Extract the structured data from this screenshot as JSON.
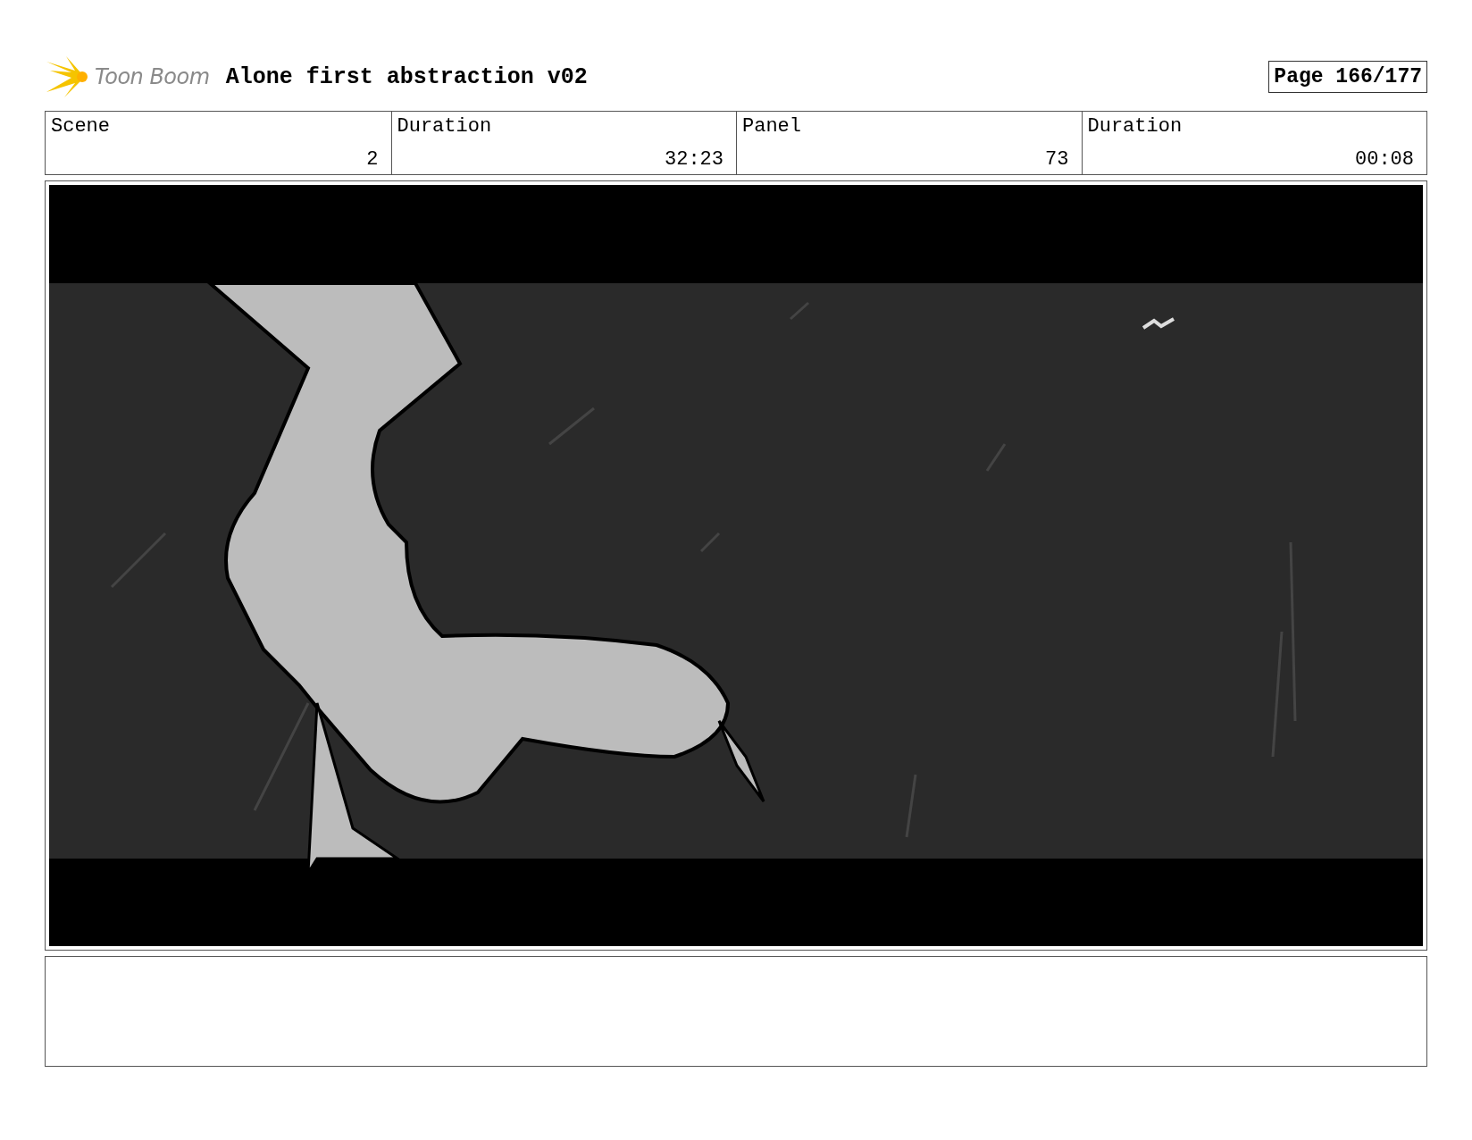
{
  "header": {
    "logo_text": "Toon Boom",
    "title": "Alone first abstraction v02",
    "page": "Page 166/177"
  },
  "info": [
    {
      "label": "Scene",
      "value": "2"
    },
    {
      "label": "Duration",
      "value": "32:23"
    },
    {
      "label": "Panel",
      "value": "73"
    },
    {
      "label": "Duration",
      "value": "00:08"
    }
  ]
}
